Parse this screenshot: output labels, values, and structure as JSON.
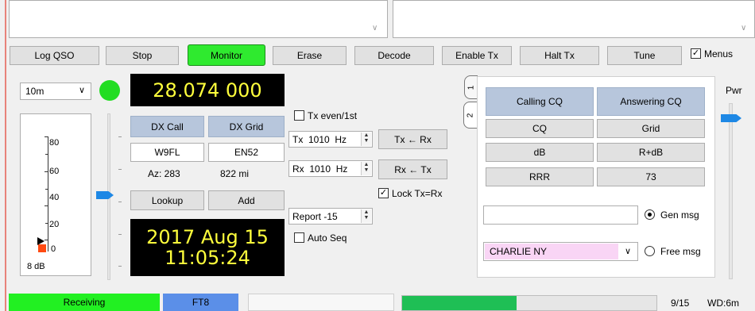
{
  "toolbar": {
    "log_qso": "Log QSO",
    "stop": "Stop",
    "monitor": "Monitor",
    "erase": "Erase",
    "decode": "Decode",
    "enable_tx": "Enable Tx",
    "halt_tx": "Halt Tx",
    "tune": "Tune",
    "menus_label": "Menus",
    "menus_checked": true
  },
  "band": {
    "selected": "10m",
    "status_color": "#22dd22"
  },
  "frequency": "28.074 000",
  "dx": {
    "call_header": "DX Call",
    "grid_header": "DX Grid",
    "call": "W9FL",
    "grid": "EN52",
    "az": "Az: 283",
    "distance": "822 mi",
    "lookup": "Lookup",
    "add": "Add"
  },
  "clock": {
    "date": "2017 Aug 15",
    "time": "11:05:24"
  },
  "meter": {
    "ticks": [
      "80",
      "60",
      "40",
      "20",
      "0"
    ],
    "readout": "8 dB",
    "level_db": 8
  },
  "tx_rx": {
    "tx_even_label": "Tx even/1st",
    "tx_freq": "Tx  1010  Hz",
    "rx_freq": "Rx  1010  Hz",
    "tx_from_rx": "Tx ← Rx",
    "rx_from_tx": "Rx ← Tx",
    "lock_label": "Lock Tx=Rx",
    "lock_checked": true,
    "report": "Report -15",
    "auto_seq_label": "Auto Seq"
  },
  "tabs": [
    "1",
    "2"
  ],
  "messages": {
    "calling_cq": "Calling CQ",
    "answering_cq": "Answering CQ",
    "cq": "CQ",
    "grid": "Grid",
    "db": "dB",
    "r_db": "R+dB",
    "rrr": "RRR",
    "seventy_three": "73",
    "gen_msg_label": "Gen msg",
    "free_msg_label": "Free msg",
    "free_msg_value": "CHARLIE NY"
  },
  "pwr_label": "Pwr",
  "status": {
    "receiving": "Receiving",
    "mode": "FT8",
    "progress_fraction": 0.45,
    "sequence": "9/15",
    "wd": "WD:6m"
  },
  "colors": {
    "monitor_on": "#2fea2f",
    "receiving": "#22f022",
    "mode_bg": "#5b8fe8",
    "progress": "#1fbf55",
    "lcd_text": "#ffff3c",
    "header_blue": "#b7c6dc",
    "free_msg_bg": "#f9d5f5"
  }
}
